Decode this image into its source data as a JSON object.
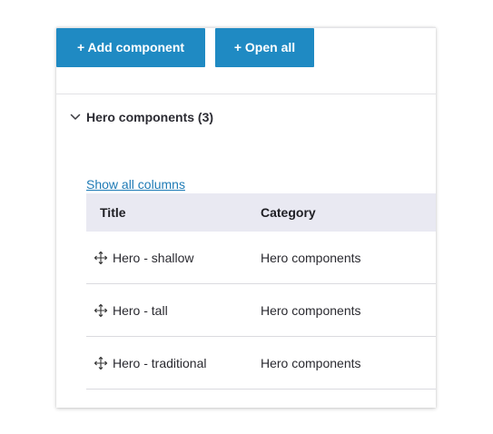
{
  "toolbar": {
    "add_label": "+ Add component",
    "open_label": "+ Open all"
  },
  "section": {
    "title": "Hero components (3)",
    "show_all_columns": "Show all columns",
    "columns": {
      "title": "Title",
      "category": "Category"
    },
    "rows": [
      {
        "title": "Hero - shallow",
        "category": "Hero components"
      },
      {
        "title": "Hero - tall",
        "category": "Hero components"
      },
      {
        "title": "Hero - traditional",
        "category": "Hero components"
      }
    ]
  },
  "icons": {
    "toggle": "chevron-down-icon",
    "drag": "move-handle-icon"
  },
  "colors": {
    "button_bg": "#1f8ac3",
    "link": "#1f7bb6",
    "table_header_bg": "#e9e9f2"
  }
}
